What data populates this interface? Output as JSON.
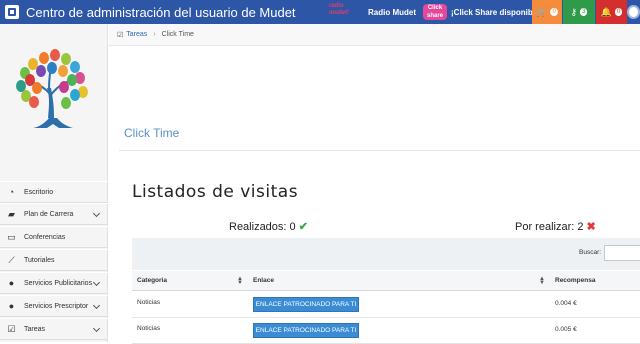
{
  "header": {
    "title": "Centro de administración del usuario de Mudet",
    "radio_logo": "radio mudet!",
    "radio_label": "Radio Mudet",
    "share_logo": "Click share",
    "share_label": "¡Click Share disponible!",
    "cart_count": "0",
    "keys_count": "3",
    "bell_count": "0"
  },
  "sidebar": {
    "items": [
      {
        "label": "Escritorio",
        "icon": "dashboard-icon"
      },
      {
        "label": "Plan de Carrera",
        "icon": "briefcase-icon",
        "expandable": true
      },
      {
        "label": "Conferencias",
        "icon": "monitor-icon"
      },
      {
        "label": "Tutoriales",
        "icon": "wand-icon"
      },
      {
        "label": "Servicios Publicitarios",
        "icon": "coins-icon",
        "expandable": true
      },
      {
        "label": "Servicios Prescriptor",
        "icon": "coins-icon",
        "expandable": true
      },
      {
        "label": "Tareas",
        "icon": "checkbox-icon",
        "expandable": true
      }
    ]
  },
  "breadcrumb": {
    "link": "Tareas",
    "current": "Click Time"
  },
  "main": {
    "page_title": "Click Time",
    "section_title": "Listados de visitas",
    "done_label": "Realizados: 0",
    "pending_label": "Por realizar: 2",
    "search_label": "Buscar:",
    "search_value": ""
  },
  "table": {
    "headers": [
      "Categoria",
      "Enlace",
      "Recompensa"
    ],
    "rows": [
      {
        "category": "Noticias",
        "link_label": "ENLACE PATROCINADO PARA TI",
        "reward": "0.004 €"
      },
      {
        "category": "Noticias",
        "link_label": "ENLACE PATROCINADO PARA TI",
        "reward": "0.005 €"
      }
    ]
  },
  "colors": {
    "topbar": "#2d57a6",
    "cart": "#f58c3c",
    "keys": "#2f9a49",
    "bell": "#d42f2f",
    "title_blue": "#5b8fc7",
    "button_blue": "#3a8cd4"
  }
}
